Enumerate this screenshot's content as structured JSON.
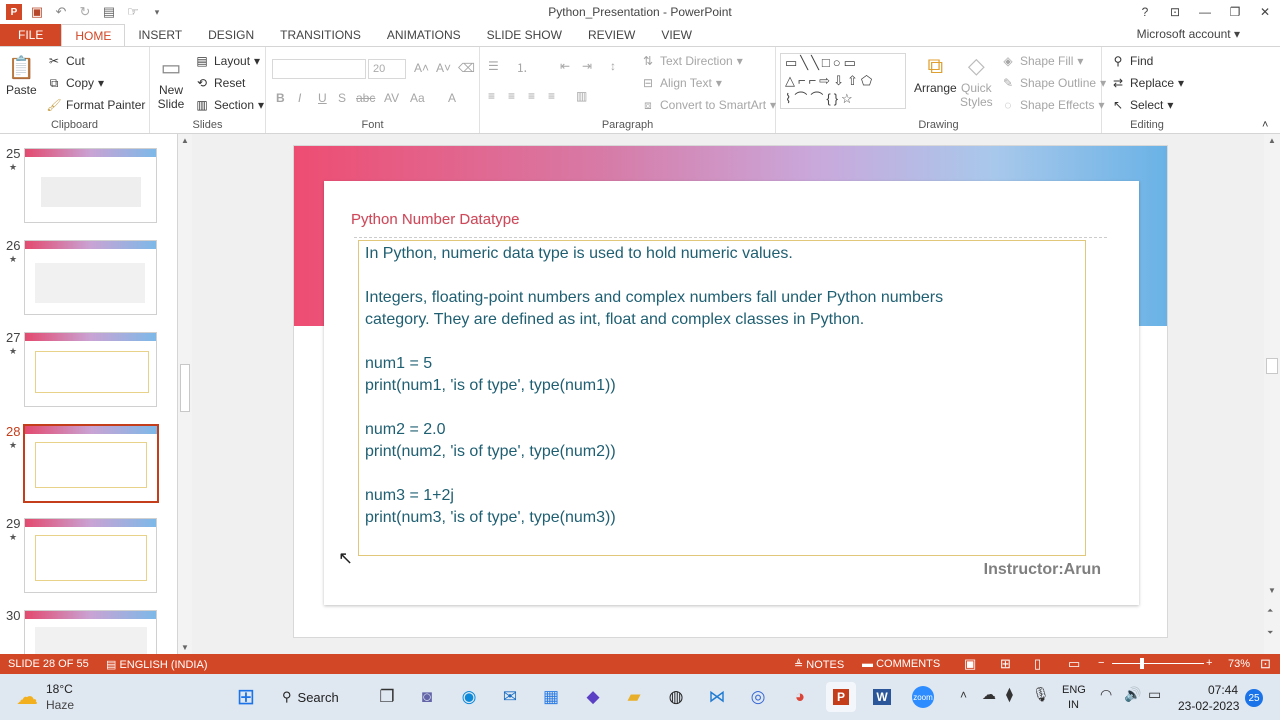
{
  "window": {
    "title": "Python_Presentation - PowerPoint",
    "account": "Microsoft account"
  },
  "tabs": [
    "FILE",
    "HOME",
    "INSERT",
    "DESIGN",
    "TRANSITIONS",
    "ANIMATIONS",
    "SLIDE SHOW",
    "REVIEW",
    "VIEW"
  ],
  "ribbon": {
    "clipboard": {
      "label": "Clipboard",
      "paste": "Paste",
      "cut": "Cut",
      "copy": "Copy",
      "format_painter": "Format Painter"
    },
    "slides": {
      "label": "Slides",
      "new_slide_line1": "New",
      "new_slide_line2": "Slide",
      "layout": "Layout",
      "reset": "Reset",
      "section": "Section"
    },
    "font": {
      "label": "Font",
      "size": "20"
    },
    "paragraph": {
      "label": "Paragraph",
      "text_direction": "Text Direction",
      "align_text": "Align Text",
      "convert": "Convert to SmartArt"
    },
    "drawing": {
      "label": "Drawing",
      "arrange": "Arrange",
      "quick_styles_line1": "Quick",
      "quick_styles_line2": "Styles",
      "shape_fill": "Shape Fill",
      "shape_outline": "Shape Outline",
      "shape_effects": "Shape Effects"
    },
    "editing": {
      "label": "Editing",
      "find": "Find",
      "replace": "Replace",
      "select": "Select"
    }
  },
  "thumbnails": [
    {
      "num": "25",
      "selected": false
    },
    {
      "num": "26",
      "selected": false
    },
    {
      "num": "27",
      "selected": false
    },
    {
      "num": "28",
      "selected": true
    },
    {
      "num": "29",
      "selected": false
    },
    {
      "num": "30",
      "selected": false
    }
  ],
  "slide": {
    "title": "Python Number Datatype",
    "lines": [
      "In Python, numeric data type is used to hold numeric values.",
      "Integers, floating-point numbers and complex numbers fall under Python numbers",
      "category. They are defined as int, float and complex classes in Python.",
      "num1 = 5",
      "print(num1, 'is of type', type(num1))",
      "num2 = 2.0",
      "print(num2, 'is of type', type(num2))",
      "num3 = 1+2j",
      "print(num3, 'is of type', type(num3))"
    ],
    "instructor": "Instructor:Arun"
  },
  "status": {
    "slide": "SLIDE 28 OF 55",
    "language": "ENGLISH (INDIA)",
    "notes": "NOTES",
    "comments": "COMMENTS",
    "zoom": "73%"
  },
  "taskbar": {
    "temp": "18°C",
    "weather": "Haze",
    "search": "Search",
    "lang1": "ENG",
    "lang2": "IN",
    "time": "07:44",
    "date": "23-02-2023",
    "badge": "25"
  }
}
